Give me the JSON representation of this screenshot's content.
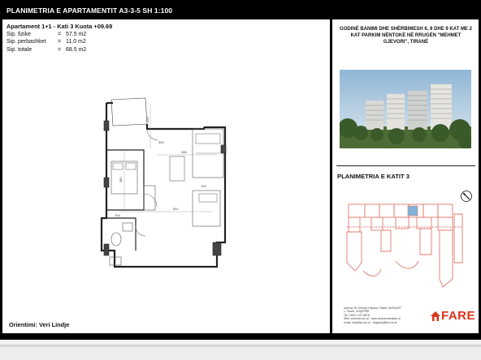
{
  "header": {
    "title": "PLANIMETRIA E APARTAMENTIT A3-3-5  SH 1:100"
  },
  "apartment": {
    "heading": "Apartament 1+1 -  Kati 3   Kuota  +09.69",
    "rows": [
      {
        "label": "Sip. fizike",
        "eq": "=",
        "value": "57.5 m2"
      },
      {
        "label": "Sip. perbashket",
        "eq": "=",
        "value": "11.0 m2"
      },
      {
        "label": "Sip. totale",
        "eq": "=",
        "value": "68.5 m2"
      }
    ]
  },
  "orientation": "Orientimi: Veri Lindje",
  "plan_dims": {
    "d1": "150",
    "d2": "386",
    "d3": "380",
    "d4": "651",
    "d5": "194",
    "d6": "350",
    "d7": "193"
  },
  "project": {
    "description": "GODINË BANIMI DHE SHËRBIMESH 6, 8 DHE 9 KAT ME 2 KAT PARKIM NËNTOKË NË RRUGËN \"MEHMET GJEVORI\", TIRANË"
  },
  "floor": {
    "title": "PLANIMETRIA E KATIT 3"
  },
  "contact": {
    "line1": "Adresa: Rr. Dervish Hekalai, Pallati \"ANZUART\"",
    "line2": "Tel: +355 4 237 8878",
    "line3": "1, Tiranë, SHQIPËRI",
    "line4": "Web: www.fim-sm.al  ·  www.nestorrealestate.al",
    "line5": "email: info@fim-sm.al  ·  tregtaria@fim-sm.al"
  },
  "logo": {
    "text": "FARE",
    "color": "#d9341c"
  },
  "colors": {
    "sheet": "#000000",
    "keyplan": "#e07a6a",
    "highlight": "#7fb3d9"
  },
  "icons": [
    "compass-north-icon",
    "house-logo-icon"
  ]
}
